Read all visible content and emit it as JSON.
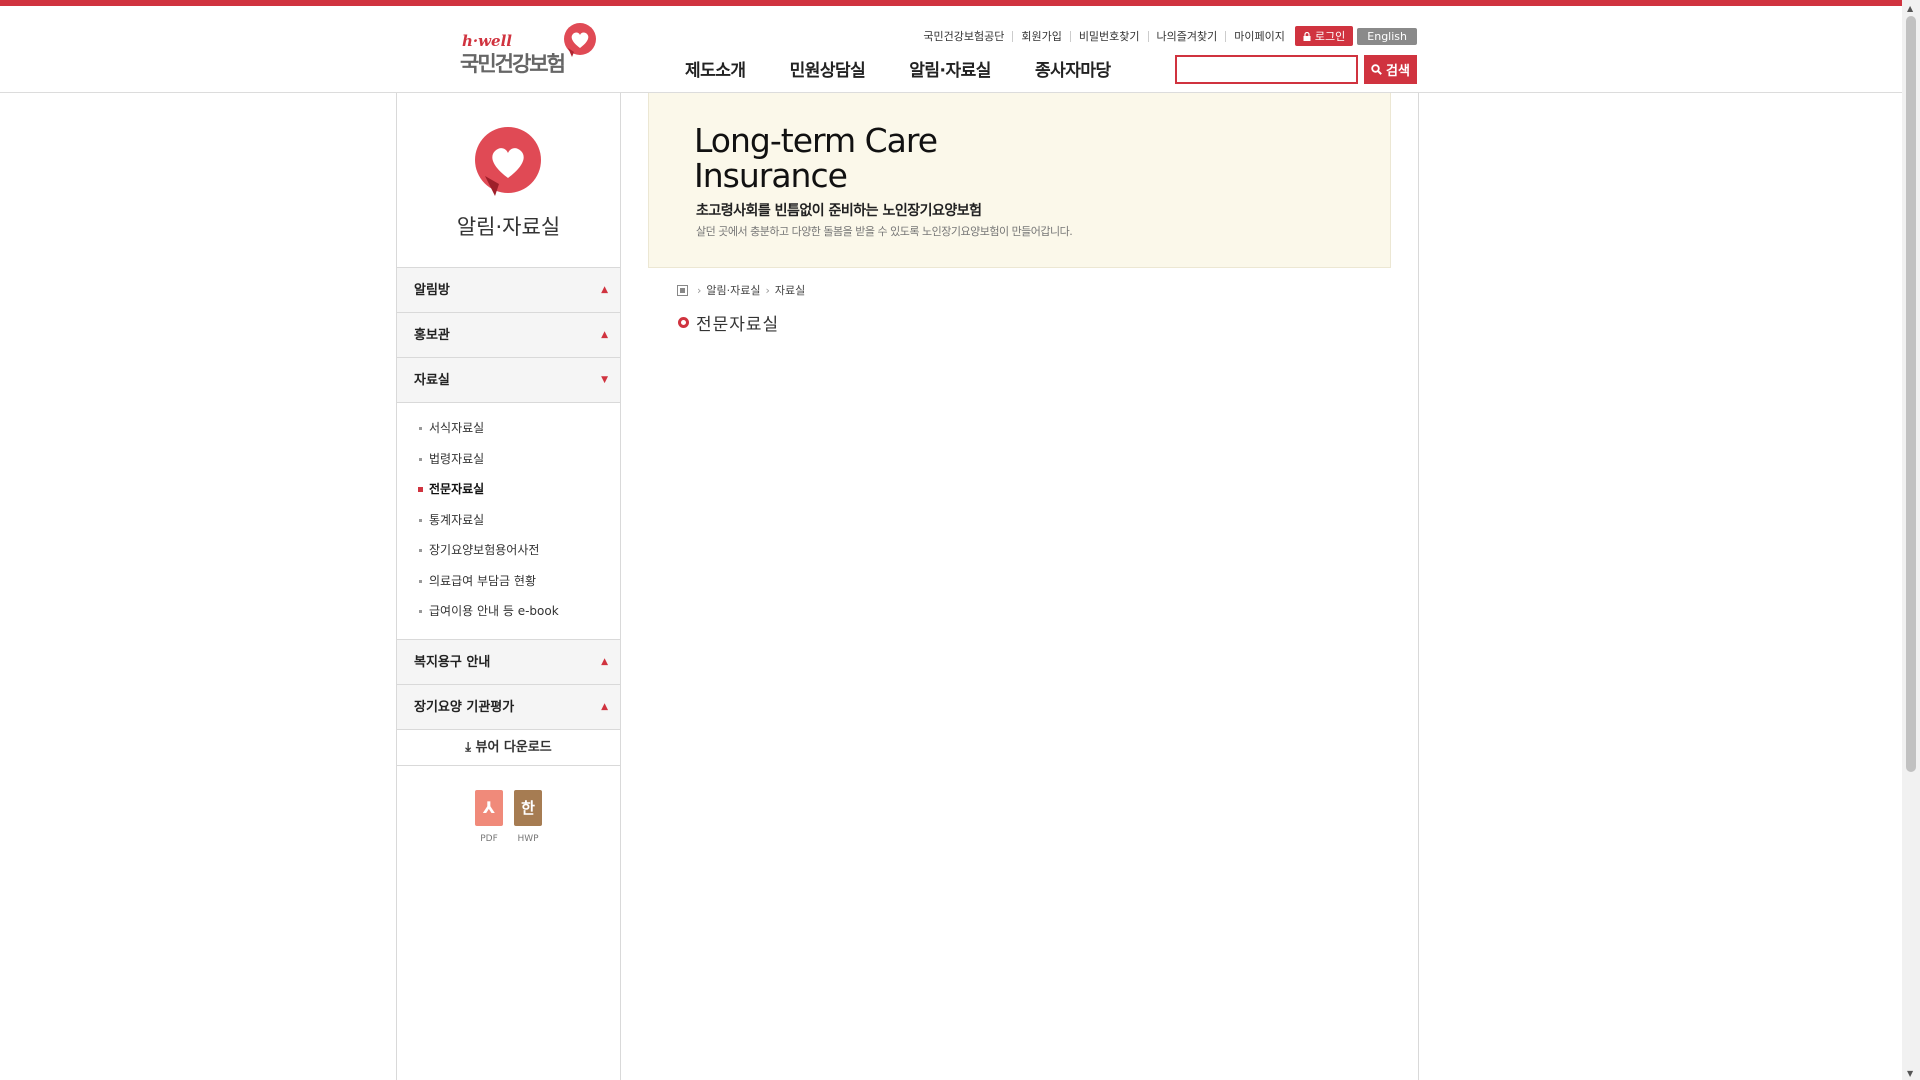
{
  "header": {
    "logo_en": "h·well",
    "logo_ko": "국민건강보험",
    "util_links": [
      "국민건강보험공단",
      "회원가입",
      "비밀번호찾기",
      "나의즐겨찾기",
      "마이페이지"
    ],
    "login_label": "로그인",
    "english_label": "English",
    "gnb": [
      "제도소개",
      "민원상담실",
      "알림·자료실",
      "종사자마당"
    ],
    "search_placeholder": "",
    "search_label": "검색"
  },
  "sidebar": {
    "title": "알림·자료실",
    "items": [
      {
        "label": "알림방"
      },
      {
        "label": "홍보관"
      },
      {
        "label": "자료실"
      },
      {
        "label": "복지용구 안내"
      },
      {
        "label": "장기요양 기관평가"
      }
    ],
    "sub_items": [
      "서식자료실",
      "법령자료실",
      "전문자료실",
      "통계자료실",
      "장기요양보험용어사전",
      "의료급여 부담금 현황",
      "급여이용 안내 등 e-book"
    ],
    "viewer_label": "뷰어 다운로드",
    "files": [
      {
        "glyph": "⅄",
        "caption": "PDF",
        "color": "#f08a7a"
      },
      {
        "glyph": "한",
        "caption": "HWP",
        "color": "#a67c52"
      }
    ]
  },
  "banner": {
    "title_line1": "Long-term Care",
    "title_line2": "Insurance",
    "ko_title": "초고령사회를 빈틈없이 준비하는 노인장기요양보험",
    "ko_desc": "살던 곳에서 충분하고 다양한 돌봄을 받을 수 있도록 노인장기요양보험이 만들어갑니다."
  },
  "breadcrumb": [
    "알림·자료실",
    "자료실"
  ],
  "page_title": "전문자료실",
  "colors": {
    "accent": "#d0333f",
    "gray_button": "#8a8a8a"
  }
}
